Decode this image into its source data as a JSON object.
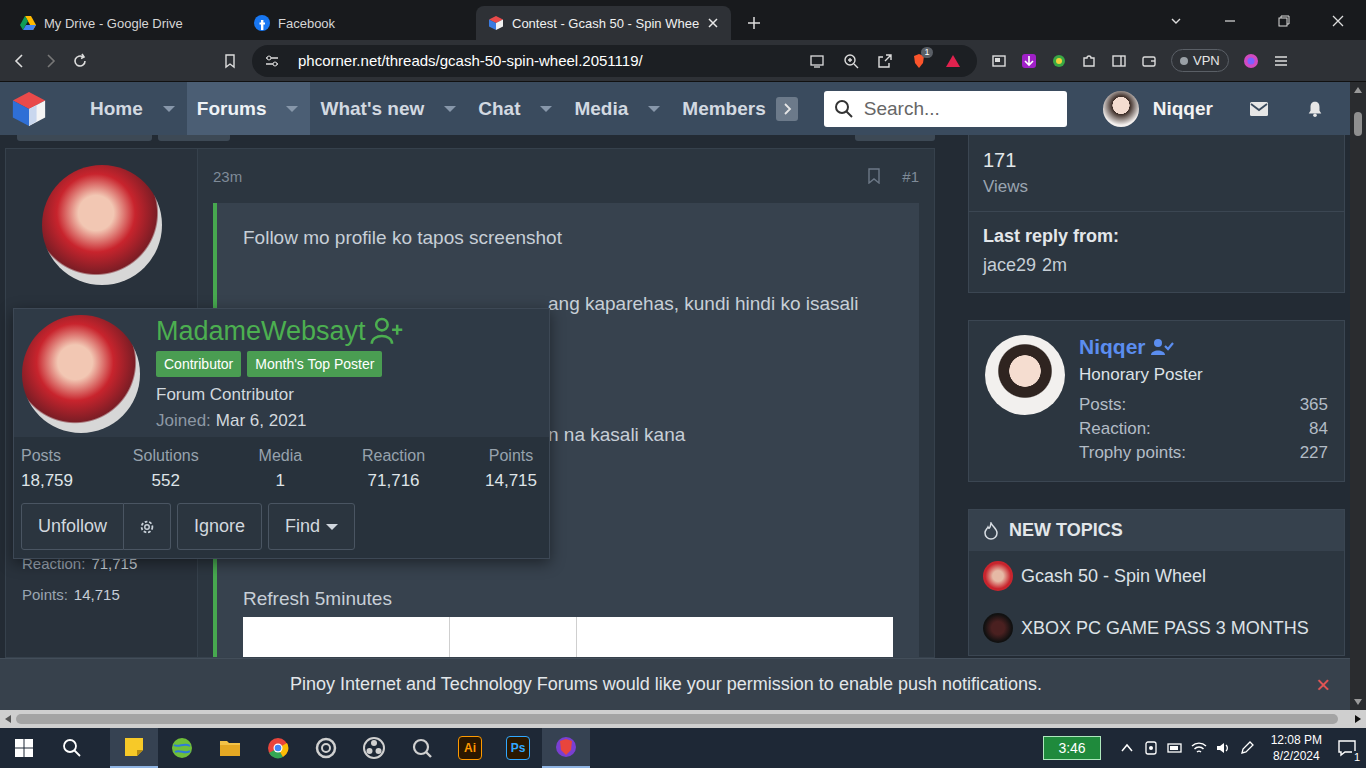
{
  "browser": {
    "tabs": [
      {
        "title": "My Drive - Google Drive",
        "selected": false,
        "kind": "drive"
      },
      {
        "title": "Facebook",
        "selected": false,
        "kind": "facebook"
      },
      {
        "title": "Contest - Gcash 50 - Spin Whee",
        "selected": true,
        "kind": "phc"
      }
    ],
    "url": "phcorner.net/threads/gcash-50-spin-wheel.2051119/",
    "shieldBadge": "1",
    "vpn": "VPN"
  },
  "nav": {
    "items": [
      {
        "label": "Home",
        "selected": false,
        "caret": true
      },
      {
        "label": "Forums",
        "selected": true,
        "caret": true
      },
      {
        "label": "What's new",
        "selected": false,
        "caret": true
      },
      {
        "label": "Chat",
        "selected": false,
        "caret": true
      },
      {
        "label": "Media",
        "selected": false,
        "caret": true
      },
      {
        "label": "Members",
        "selected": false,
        "caret": false
      }
    ],
    "searchPlaceholder": "Search...",
    "user": "Niqqer"
  },
  "post": {
    "time": "23m",
    "number": "#1",
    "lines": [
      {
        "text": "Follow mo profile ko tapos screenshot",
        "kind": "full"
      },
      {
        "text": "ang kaparehas, kundi hindi ko isasali",
        "kind": "cut"
      },
      {
        "text": "n na kasali kana",
        "kind": "cut"
      },
      {
        "text": "Refresh 5minutes",
        "kind": "full"
      }
    ],
    "authorStats": [
      {
        "label": "Reaction:",
        "value": "71,715"
      },
      {
        "label": "Points:",
        "value": "14,715"
      }
    ]
  },
  "profileCard": {
    "name": "MadameWebsayt",
    "badges": [
      "Contributor",
      "Month's Top Poster"
    ],
    "title": "Forum Contributor",
    "joinedLabel": "Joined:",
    "joined": "Mar 6, 2021",
    "stats": [
      {
        "label": "Posts",
        "value": "18,759"
      },
      {
        "label": "Solutions",
        "value": "552"
      },
      {
        "label": "Media",
        "value": "1"
      },
      {
        "label": "Reaction",
        "value": "71,716"
      },
      {
        "label": "Points",
        "value": "14,715"
      }
    ],
    "buttons": {
      "unfollow": "Unfollow",
      "ignore": "Ignore",
      "find": "Find"
    }
  },
  "sidebar": {
    "views": "171",
    "viewsLabel": "Views",
    "lastReplyLabel": "Last reply from:",
    "lastReplyUser": "jace29",
    "lastReplyTime": "2m",
    "user": {
      "name": "Niqqer",
      "title": "Honorary Poster",
      "stats": [
        {
          "label": "Posts:",
          "value": "365"
        },
        {
          "label": "Reaction:",
          "value": "84"
        },
        {
          "label": "Trophy points:",
          "value": "227"
        }
      ]
    },
    "newTopicsTitle": "NEW TOPICS",
    "newTopics": [
      "Gcash 50 - Spin Wheel",
      "XBOX PC GAME PASS 3 MONTHS"
    ]
  },
  "notification": {
    "text": "Pinoy Internet and Technology Forums would like your permission to enable push notifications.",
    "close": "×"
  },
  "taskbar": {
    "apps": [
      {
        "kind": "notes",
        "selected": true,
        "label": "",
        "color": "#f7c928"
      },
      {
        "kind": "globe",
        "selected": false,
        "label": "",
        "color": "#6fbf3a"
      },
      {
        "kind": "folder",
        "selected": false,
        "label": "",
        "color": "#f3c247"
      },
      {
        "kind": "chrome",
        "selected": false,
        "label": "",
        "color": "#e8453c"
      },
      {
        "kind": "ring",
        "selected": false,
        "label": "",
        "color": "#d0d0d0"
      },
      {
        "kind": "obs",
        "selected": false,
        "label": "",
        "color": "#d0d0d0"
      },
      {
        "kind": "search",
        "selected": false,
        "label": "",
        "color": "#d0d0d0"
      },
      {
        "kind": "label",
        "selected": false,
        "label": "Ai",
        "color": "#ff9a00"
      },
      {
        "kind": "label",
        "selected": false,
        "label": "Ps",
        "color": "#31a8ff"
      },
      {
        "kind": "brave",
        "selected": true,
        "label": "",
        "color": "#e8453c"
      }
    ],
    "battery": "3:46",
    "time": "12:08 PM",
    "date": "8/2/2024",
    "notificationCount": "1"
  }
}
